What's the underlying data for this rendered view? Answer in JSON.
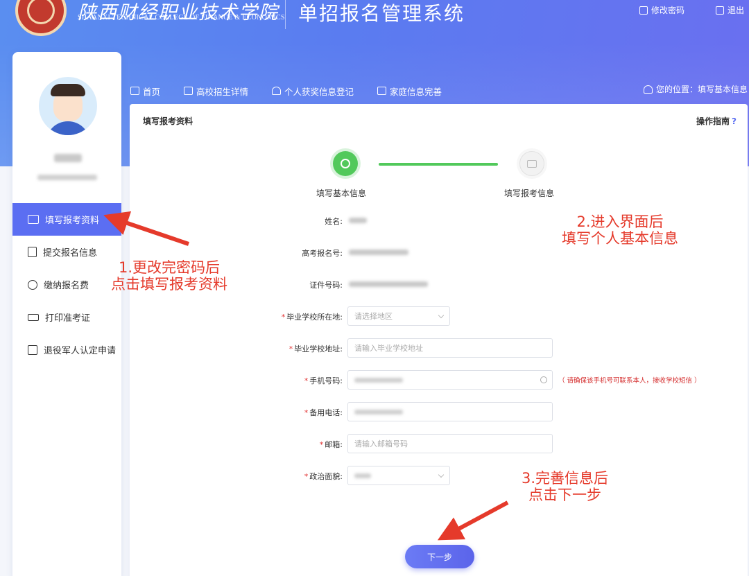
{
  "header": {
    "school_cn": "陕西财经职业技术学院",
    "school_en": "SHAANXI TECHNICAL COLLEGE OF FINANCE & ECONOMICS",
    "system_title": "单招报名管理系统",
    "change_password": "修改密码",
    "logout": "退出"
  },
  "topnav": {
    "items": [
      {
        "label": "首页",
        "icon": "home-icon"
      },
      {
        "label": "高校招生详情",
        "icon": "document-icon"
      },
      {
        "label": "个人获奖信息登记",
        "icon": "person-icon"
      },
      {
        "label": "家庭信息完善",
        "icon": "form-icon"
      }
    ],
    "location": "您的位置：填写基本信息"
  },
  "sidebar": {
    "items": [
      {
        "label": "填写报考资料",
        "icon": "id-card-icon",
        "active": true
      },
      {
        "label": "提交报名信息",
        "icon": "list-icon"
      },
      {
        "label": "缴纳报名费",
        "icon": "yuan-icon"
      },
      {
        "label": "打印准考证",
        "icon": "printer-icon"
      },
      {
        "label": "退役军人认定申请",
        "icon": "form-icon"
      }
    ]
  },
  "card": {
    "title": "填写报考资料",
    "guide": "操作指南",
    "guide_icon": "?"
  },
  "steps": [
    {
      "label": "填写基本信息",
      "status": "active"
    },
    {
      "label": "填写报考信息",
      "status": "pending"
    }
  ],
  "form": {
    "name_label": "姓名:",
    "exam_no_label": "高考报名号:",
    "id_label": "证件号码:",
    "school_region_label": "毕业学校所在地:",
    "school_region_placeholder": "请选择地区",
    "school_addr_label": "毕业学校地址:",
    "school_addr_placeholder": "请输入毕业学校地址",
    "phone_label": "手机号码:",
    "phone_hint": "（ 请确保该手机号可联系本人，接收学校短信 ）",
    "backup_phone_label": "备用电话:",
    "email_label": "邮箱:",
    "email_placeholder": "请输入邮箱号码",
    "political_label": "政治面貌:",
    "next_button": "下一步"
  },
  "annotations": {
    "a1_line1": "1.更改完密码后",
    "a1_line2": "点击填写报考资料",
    "a2_line1": "2.进入界面后",
    "a2_line2": "填写个人基本信息",
    "a3_line1": "3.完善信息后",
    "a3_line2": "点击下一步"
  },
  "colors": {
    "accent": "#5b6ef2",
    "step_done": "#52c95b",
    "annotation": "#e53a2b",
    "required": "#e23030"
  }
}
